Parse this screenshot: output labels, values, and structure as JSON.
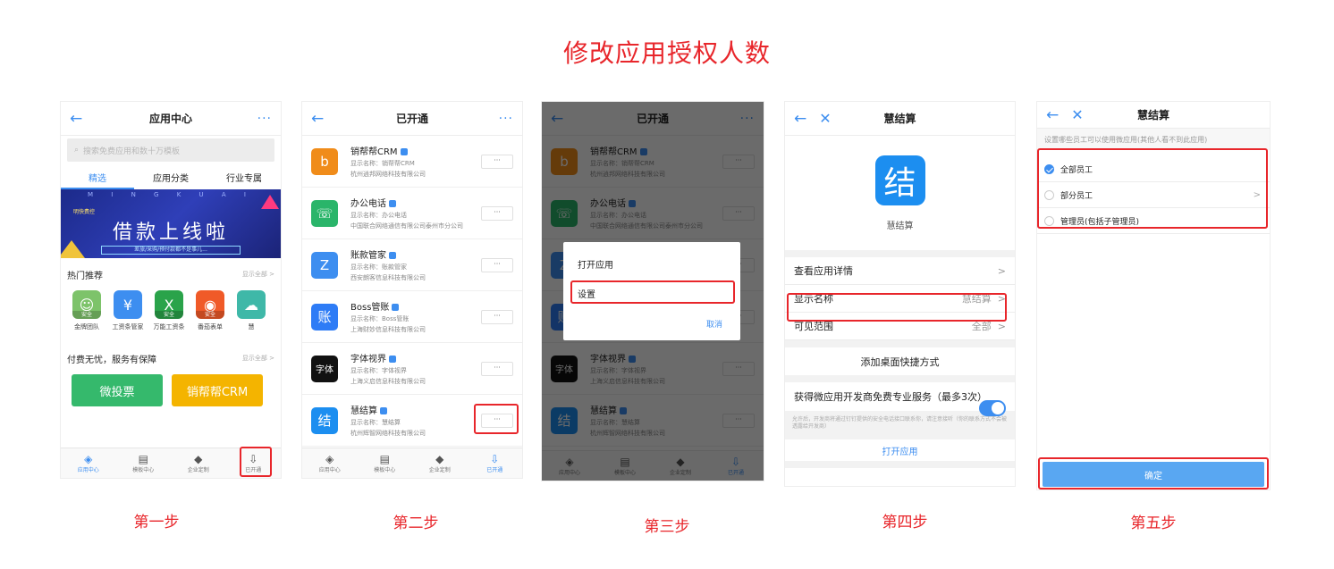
{
  "page_title": "修改应用授权人数",
  "steps": [
    "第一步",
    "第二步",
    "第三步",
    "第四步",
    "第五步"
  ],
  "screen1": {
    "title": "应用中心",
    "search_placeholder": "搜索免费应用和数十万模板",
    "tabs": [
      "精选",
      "应用分类",
      "行业专属"
    ],
    "banner": {
      "letters": "M I N G K U A I",
      "tag": "明快费控",
      "headline": "借款上线啦",
      "sub": "差旅/采购/预付款都不是事儿..."
    },
    "hot_title": "热门推荐",
    "show_all": "显示全部 >",
    "apps": [
      {
        "label": "金牌团队",
        "icon": "☺",
        "color": "#7dc36a",
        "safe": "安全"
      },
      {
        "label": "工资条管家",
        "icon": "¥",
        "color": "#3d8ef0",
        "safe": ""
      },
      {
        "label": "万能工资条",
        "icon": "X",
        "color": "#2aa34a",
        "safe": "安全"
      },
      {
        "label": "番茄表单",
        "icon": "◉",
        "color": "#f05a28",
        "safe": "安全"
      },
      {
        "label": "慧",
        "icon": "☁",
        "color": "#3fb8a8",
        "safe": ""
      }
    ],
    "paid_title": "付费无忧，服务有保障",
    "cards": [
      {
        "label": "微投票",
        "color": "#35b96c"
      },
      {
        "label": "销帮帮CRM",
        "color": "#f4b400"
      }
    ]
  },
  "tabbar": [
    {
      "label": "应用中心",
      "icon": "◈"
    },
    {
      "label": "模板中心",
      "icon": "▤"
    },
    {
      "label": "企业定制",
      "icon": "◆"
    },
    {
      "label": "已开通",
      "icon": "⇩"
    }
  ],
  "screen2": {
    "title": "已开通",
    "button_label": "···",
    "apps": [
      {
        "name": "销帮帮CRM",
        "display": "显示名称：销帮帮CRM",
        "company": "杭州逍邦网络科技有限公司",
        "icon": "b",
        "color": "#f08c1a"
      },
      {
        "name": "办公电话",
        "display": "显示名称：办公电话",
        "company": "中国联合网络通信有限公司泰州市分公司",
        "icon": "☏",
        "color": "#2ab56a"
      },
      {
        "name": "账款管家",
        "display": "显示名称：账款管家",
        "company": "西安朗客信息科技有限公司",
        "icon": "Z",
        "color": "#3d8ef0"
      },
      {
        "name": "Boss管账",
        "display": "显示名称：Boss管账",
        "company": "上海财妙信息科技有限公司",
        "icon": "账",
        "color": "#2e7cf6"
      },
      {
        "name": "字体视界",
        "display": "显示名称：字体视界",
        "company": "上海义启信息科技有限公司",
        "icon": "字体",
        "color": "#111111"
      },
      {
        "name": "慧结算",
        "display": "显示名称：慧结算",
        "company": "杭州辉智网络科技有限公司",
        "icon": "结",
        "color": "#1c8ef0"
      }
    ]
  },
  "screen3": {
    "dialog_open": "打开应用",
    "dialog_settings": "设置",
    "dialog_cancel": "取消"
  },
  "screen4": {
    "title": "慧结算",
    "logo_char": "结",
    "app_name": "慧结算",
    "rows": [
      {
        "label": "查看应用详情",
        "value": ""
      },
      {
        "label": "显示名称",
        "value": "慧结算"
      },
      {
        "label": "可见范围",
        "value": "全部"
      }
    ],
    "add_shortcut": "添加桌面快捷方式",
    "promo": "获得微应用开发商免费专业服务（最多3次）",
    "note": "允许后，开发商将通过钉钉提供的安全电话接口联系你，请注意接听（你的联系方式不会被透露给开发商）",
    "open_app": "打开应用"
  },
  "screen5": {
    "title": "慧结算",
    "hint": "设置哪些员工可以使用微应用(其他人看不到此应用)",
    "options": [
      {
        "label": "全部员工",
        "checked": true,
        "arrow": false
      },
      {
        "label": "部分员工",
        "checked": false,
        "arrow": true
      },
      {
        "label": "管理员(包括子管理员)",
        "checked": false,
        "arrow": false
      }
    ],
    "confirm": "确定"
  },
  "colors": {
    "accent_red": "#e8262b",
    "primary_blue": "#3d8ef0"
  }
}
